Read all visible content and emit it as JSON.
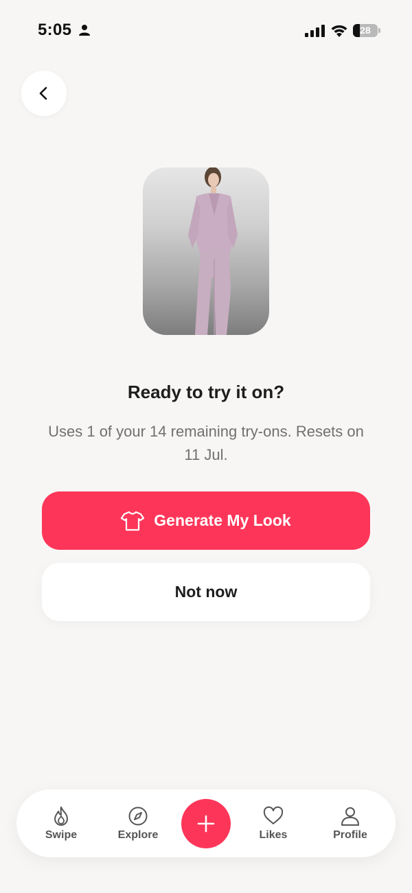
{
  "status_bar": {
    "time": "5:05",
    "battery_level": "28",
    "battery_fraction": 0.28
  },
  "back_button": {
    "icon": "chevron-left-icon"
  },
  "product_image": {
    "description_icon": "outfit-photo"
  },
  "modal": {
    "title": "Ready to try it on?",
    "subtitle": "Uses 1 of your 14 remaining try-ons. Resets on 11 Jul.",
    "primary_label": "Generate My Look",
    "primary_icon": "tshirt-icon",
    "secondary_label": "Not now"
  },
  "bottom_nav": {
    "items": [
      {
        "label": "Swipe",
        "icon": "flame-icon"
      },
      {
        "label": "Explore",
        "icon": "compass-icon"
      },
      {
        "label": "Likes",
        "icon": "heart-icon"
      },
      {
        "label": "Profile",
        "icon": "person-icon"
      }
    ],
    "add_icon": "plus-icon"
  },
  "colors": {
    "accent": "#fd3659",
    "background": "#f7f6f5",
    "text_primary": "#1d1d1d",
    "text_secondary": "#707070"
  }
}
